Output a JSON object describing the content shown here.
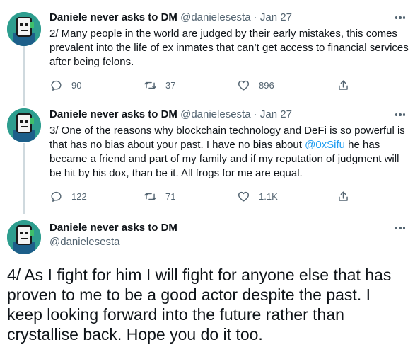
{
  "tweets": [
    {
      "name": "Daniele never asks to DM",
      "handle": "@danielesesta",
      "separator": "·",
      "date": "Jan 27",
      "text": "2/ Many people in the world are judged by their early mistakes, this comes prevalent into the life of ex inmates that can’t get access to financial services after being felons.",
      "replies": "90",
      "retweets": "37",
      "likes": "896"
    },
    {
      "name": "Daniele never asks to DM",
      "handle": "@danielesesta",
      "separator": "·",
      "date": "Jan 27",
      "text_before_link": "3/ One of the reasons why blockchain technology and DeFi is so powerful is that has no bias about your past. I have no bias about ",
      "mention": "@0xSifu",
      "text_after_link": " he has became a friend and part of my family and if my reputation of judgment will be hit by his dox, than be it. All frogs for me are equal.",
      "replies": "122",
      "retweets": "71",
      "likes": "1.1K"
    }
  ],
  "main_tweet": {
    "name": "Daniele never asks to DM",
    "handle": "@danielesesta",
    "text": "4/ As I fight for him I will fight for anyone else that has proven to me to be a good actor despite the past. I keep looking forward into the future rather than crystallise back. Hope you do it too."
  },
  "icons": [
    "more-icon",
    "reply-icon",
    "retweet-icon",
    "like-icon",
    "share-icon"
  ],
  "colors": {
    "text": "#0f1419",
    "secondary": "#536471",
    "link": "#1d9bf0",
    "thread_line": "#cfd9de",
    "avatar_bg": "#2e9e8f"
  }
}
